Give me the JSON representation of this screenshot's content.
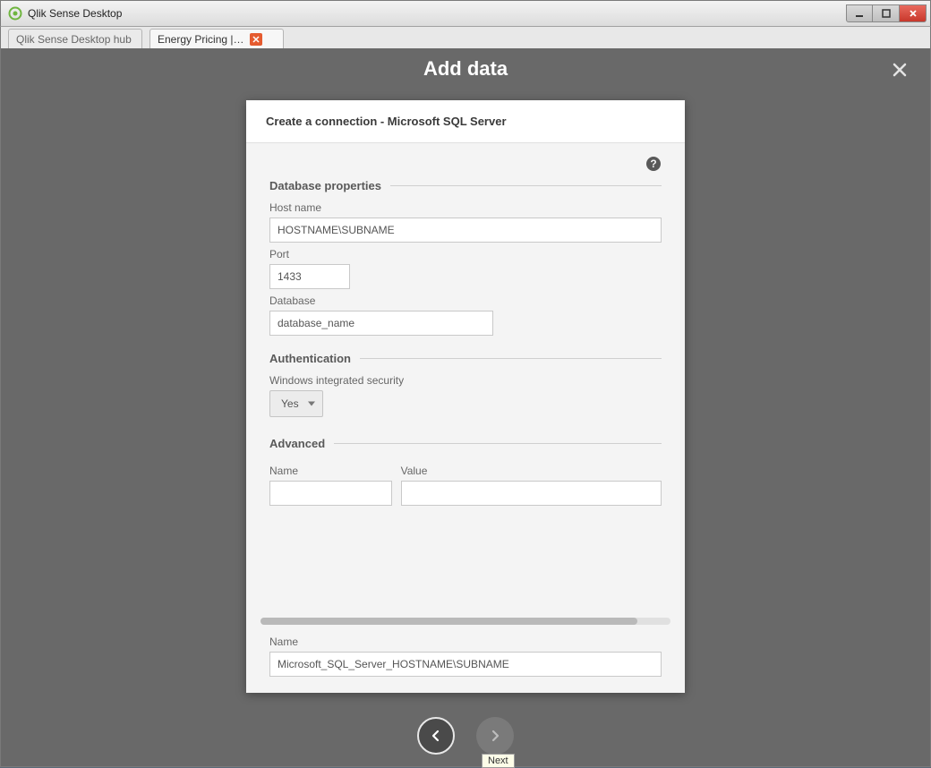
{
  "window": {
    "title": "Qlik Sense Desktop"
  },
  "tabs": [
    {
      "label": "Qlik Sense Desktop hub"
    },
    {
      "label": "Energy Pricing |…"
    }
  ],
  "overlay": {
    "title": "Add data"
  },
  "card": {
    "header": "Create a connection - Microsoft SQL Server",
    "sections": {
      "database": {
        "title": "Database properties",
        "host_label": "Host name",
        "host_value": "HOSTNAME\\SUBNAME",
        "port_label": "Port",
        "port_value": "1433",
        "db_label": "Database",
        "db_value": "database_name"
      },
      "auth": {
        "title": "Authentication",
        "integrated_label": "Windows integrated security",
        "integrated_value": "Yes"
      },
      "advanced": {
        "title": "Advanced",
        "name_label": "Name",
        "value_label": "Value",
        "name_value": "",
        "value_value": ""
      }
    },
    "footer": {
      "name_label": "Name",
      "name_value": "Microsoft_SQL_Server_HOSTNAME\\SUBNAME"
    }
  },
  "nav": {
    "next_tooltip": "Next"
  }
}
